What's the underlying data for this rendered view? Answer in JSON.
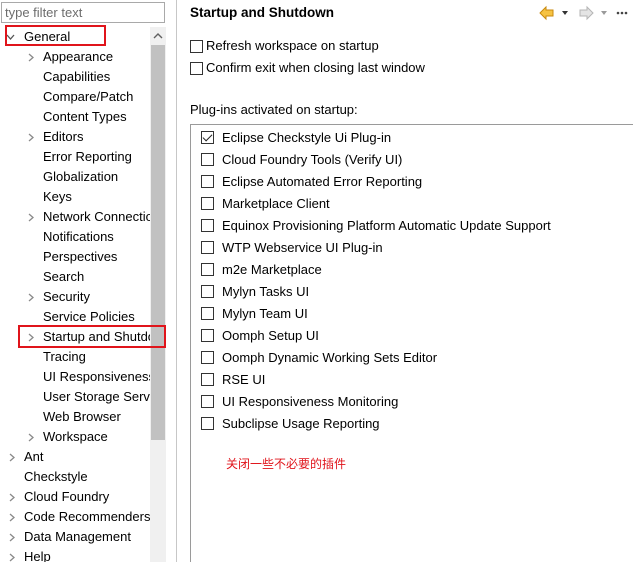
{
  "filter": {
    "placeholder": "type filter text",
    "value": ""
  },
  "tree": {
    "general": "General",
    "general_children": [
      {
        "label": "Appearance",
        "expandable": true
      },
      {
        "label": "Capabilities",
        "expandable": false
      },
      {
        "label": "Compare/Patch",
        "expandable": false
      },
      {
        "label": "Content Types",
        "expandable": false
      },
      {
        "label": "Editors",
        "expandable": true
      },
      {
        "label": "Error Reporting",
        "expandable": false
      },
      {
        "label": "Globalization",
        "expandable": false
      },
      {
        "label": "Keys",
        "expandable": false
      },
      {
        "label": "Network Connections",
        "expandable": true
      },
      {
        "label": "Notifications",
        "expandable": false
      },
      {
        "label": "Perspectives",
        "expandable": false
      },
      {
        "label": "Search",
        "expandable": false
      },
      {
        "label": "Security",
        "expandable": true
      },
      {
        "label": "Service Policies",
        "expandable": false
      },
      {
        "label": "Startup and Shutdown",
        "expandable": true
      },
      {
        "label": "Tracing",
        "expandable": false
      },
      {
        "label": "UI Responsiveness Monitoring",
        "expandable": false
      },
      {
        "label": "User Storage Service",
        "expandable": false
      },
      {
        "label": "Web Browser",
        "expandable": false
      },
      {
        "label": "Workspace",
        "expandable": true
      }
    ],
    "top_level": [
      {
        "label": "Ant",
        "expandable": true
      },
      {
        "label": "Checkstyle",
        "expandable": false
      },
      {
        "label": "Cloud Foundry",
        "expandable": true
      },
      {
        "label": "Code Recommenders",
        "expandable": true
      },
      {
        "label": "Data Management",
        "expandable": true
      },
      {
        "label": "Help",
        "expandable": true
      }
    ]
  },
  "page": {
    "title": "Startup and Shutdown",
    "refresh_workspace": {
      "label": "Refresh workspace on startup",
      "checked": false
    },
    "confirm_exit": {
      "label": "Confirm exit when closing last window",
      "checked": false
    },
    "plugins_label": "Plug-ins activated on startup:",
    "plugins": [
      {
        "label": "Eclipse Checkstyle Ui Plug-in",
        "checked": true
      },
      {
        "label": "Cloud Foundry Tools (Verify UI)",
        "checked": false
      },
      {
        "label": "Eclipse Automated Error Reporting",
        "checked": false
      },
      {
        "label": "Marketplace Client",
        "checked": false
      },
      {
        "label": "Equinox Provisioning Platform Automatic Update Support",
        "checked": false
      },
      {
        "label": "WTP Webservice UI Plug-in",
        "checked": false
      },
      {
        "label": "m2e Marketplace",
        "checked": false
      },
      {
        "label": "Mylyn Tasks UI",
        "checked": false
      },
      {
        "label": "Mylyn Team UI",
        "checked": false
      },
      {
        "label": "Oomph Setup UI",
        "checked": false
      },
      {
        "label": "Oomph Dynamic Working Sets Editor",
        "checked": false
      },
      {
        "label": "RSE UI",
        "checked": false
      },
      {
        "label": "UI Responsiveness Monitoring",
        "checked": false
      },
      {
        "label": "Subclipse Usage Reporting",
        "checked": false
      }
    ],
    "annotation": "关闭一些不必要的插件"
  },
  "colors": {
    "highlight": "#e0141b",
    "nav_back": "#e8a317",
    "nav_disabled": "#b5b5b5"
  },
  "icons": [
    "chevron-right-icon",
    "chevron-down-icon",
    "back-arrow-icon",
    "forward-arrow-icon",
    "dropdown-icon",
    "scroll-up-icon"
  ]
}
